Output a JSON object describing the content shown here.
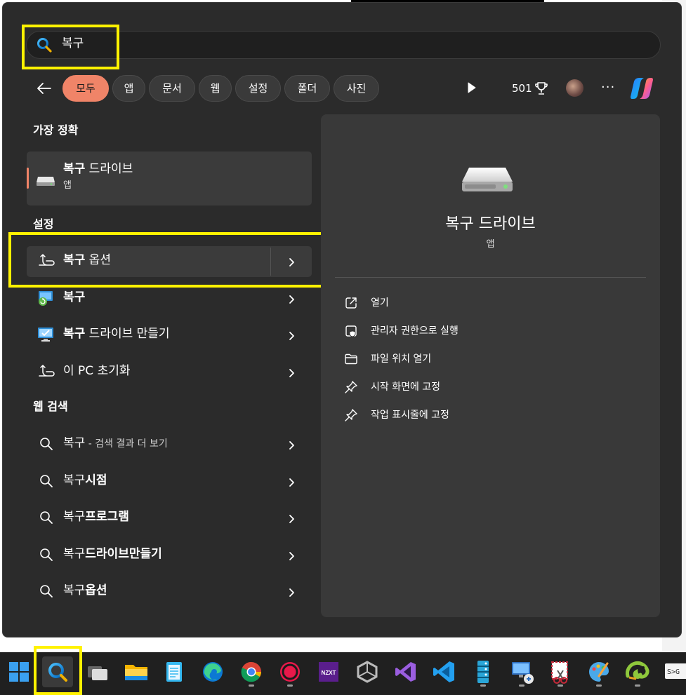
{
  "search": {
    "query": "복구"
  },
  "filters": {
    "items": [
      "모두",
      "앱",
      "문서",
      "웹",
      "설정",
      "폴더",
      "사진"
    ],
    "active": "모두"
  },
  "header": {
    "points": "501"
  },
  "sections": {
    "best_match": "가장 정확",
    "settings": "설정",
    "web_search": "웹 검색"
  },
  "best_match": {
    "title_bold": "복구",
    "title_rest": " 드라이브",
    "subtitle": "앱"
  },
  "settings_items": [
    {
      "bold": "복구",
      "rest": " 옵션"
    },
    {
      "bold": "복구",
      "rest": ""
    },
    {
      "bold": "복구",
      "rest": " 드라이브 만들기"
    },
    {
      "bold": "",
      "rest": "이 PC 초기화"
    }
  ],
  "web_items": [
    {
      "normal": "복구",
      "bold": "",
      "suffix": " - 검색 결과 더 보기"
    },
    {
      "normal": "복구",
      "bold": "시점",
      "suffix": ""
    },
    {
      "normal": "복구",
      "bold": "프로그램",
      "suffix": ""
    },
    {
      "normal": "복구",
      "bold": "드라이브만들기",
      "suffix": ""
    },
    {
      "normal": "복구",
      "bold": "옵션",
      "suffix": ""
    }
  ],
  "preview": {
    "title": "복구 드라이브",
    "subtitle": "앱",
    "actions": [
      "열기",
      "관리자 권한으로 실행",
      "파일 위치 열기",
      "시작 화면에 고정",
      "작업 표시줄에 고정"
    ]
  },
  "taskbar": {
    "icons": [
      "windows-start-icon",
      "search-icon",
      "task-view-icon",
      "file-explorer-icon",
      "notepad-icon",
      "edge-icon",
      "chrome-icon",
      "record-icon",
      "nzxt-icon",
      "unity-icon",
      "visual-studio-icon",
      "vscode-icon",
      "server-icon",
      "remote-desktop-icon",
      "snip-icon",
      "paint-icon",
      "chameleon-icon",
      "terminal-icon"
    ],
    "nzxt_label": "NZXT",
    "terminal_label": "S>G"
  },
  "colors": {
    "accent": "#f08468",
    "highlight": "#fff200",
    "panel": "#2b2b2b",
    "pane": "#393939"
  }
}
